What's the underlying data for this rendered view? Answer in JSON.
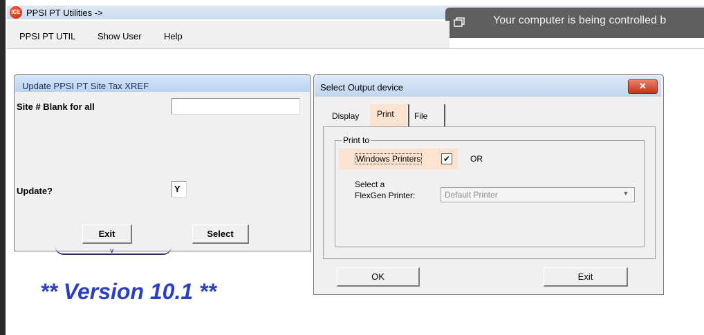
{
  "app": {
    "title": "PPSI PT Utilities ->",
    "icon_text": "ICE"
  },
  "remote_banner": {
    "text": "Your computer is being controlled b"
  },
  "menu": {
    "items": [
      "PPSI PT UTIL",
      "Show User",
      "Help"
    ]
  },
  "dialog_update": {
    "title": "Update PPSI PT Site Tax XREF",
    "site_label": "Site # Blank for all",
    "site_value": "",
    "update_label": "Update?",
    "update_value": "Y",
    "exit_label": "Exit",
    "select_label": "Select"
  },
  "version_text": "** Version 10.1 **",
  "dialog_output": {
    "title": "Select Output device",
    "close_glyph": "✕",
    "tabs": [
      "Display",
      "Print",
      "File"
    ],
    "active_tab": "Print",
    "group_label": "Print to",
    "windows_printers_label": "Windows Printers",
    "windows_printers_checked": true,
    "check_glyph": "✔",
    "or_label": "OR",
    "select_label_line1": "Select a",
    "select_label_line2": "FlexGen Printer:",
    "printer_value": "Default Printer",
    "ok_label": "OK",
    "exit_label": "Exit"
  },
  "colors": {
    "version_blue": "#2a3fc3",
    "highlight": "#fbe3cf",
    "banner_bg": "#5e5e5e"
  }
}
